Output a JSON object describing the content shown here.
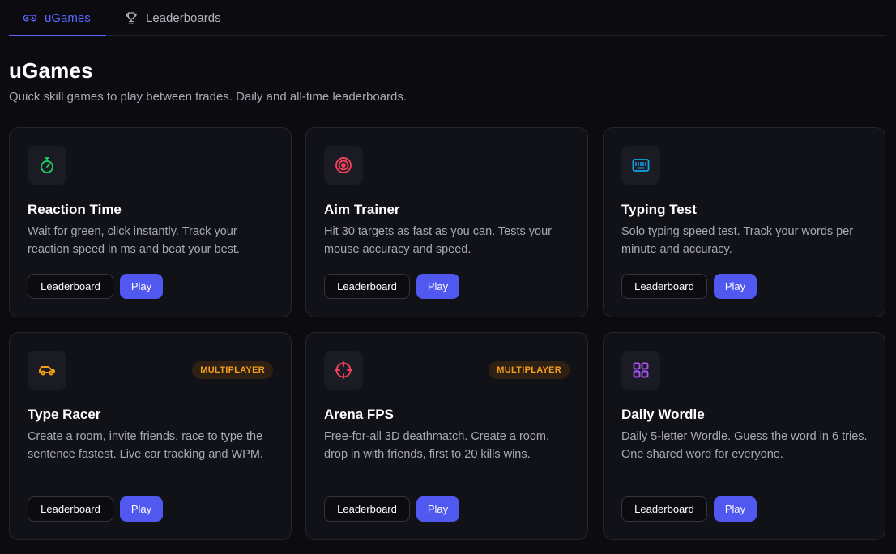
{
  "tabs": [
    {
      "label": "uGames",
      "icon": "gamepad-icon",
      "active": true
    },
    {
      "label": "Leaderboards",
      "icon": "trophy-icon",
      "active": false
    }
  ],
  "header": {
    "title": "uGames",
    "subtitle": "Quick skill games to play between trades. Daily and all-time leaderboards."
  },
  "colors": {
    "accent": "#5b67ff",
    "play_button": "#5058f0",
    "badge_text": "#f59e1b",
    "badge_bg": "#2e2113",
    "background": "#0b0b10",
    "card_bg": "#111118"
  },
  "games": [
    {
      "title": "Reaction Time",
      "description": "Wait for green, click instantly. Track your reaction speed in ms and beat your best.",
      "icon": "stopwatch-icon",
      "icon_color": "#22c55e",
      "badge": "",
      "leaderboard_label": "Leaderboard",
      "play_label": "Play"
    },
    {
      "title": "Aim Trainer",
      "description": "Hit 30 targets as fast as you can. Tests your mouse accuracy and speed.",
      "icon": "target-icon",
      "icon_color": "#f43f5e",
      "badge": "",
      "leaderboard_label": "Leaderboard",
      "play_label": "Play"
    },
    {
      "title": "Typing Test",
      "description": "Solo typing speed test. Track your words per minute and accuracy.",
      "icon": "keyboard-icon",
      "icon_color": "#0ea5e9",
      "badge": "",
      "leaderboard_label": "Leaderboard",
      "play_label": "Play"
    },
    {
      "title": "Type Racer",
      "description": "Create a room, invite friends, race to type the sentence fastest. Live car tracking and WPM.",
      "icon": "car-icon",
      "icon_color": "#f59e0b",
      "badge": "MULTIPLAYER",
      "leaderboard_label": "Leaderboard",
      "play_label": "Play"
    },
    {
      "title": "Arena FPS",
      "description": "Free-for-all 3D deathmatch. Create a room, drop in with friends, first to 20 kills wins.",
      "icon": "crosshair-icon",
      "icon_color": "#f43f5e",
      "badge": "MULTIPLAYER",
      "leaderboard_label": "Leaderboard",
      "play_label": "Play"
    },
    {
      "title": "Daily Wordle",
      "description": "Daily 5-letter Wordle. Guess the word in 6 tries. One shared word for everyone.",
      "icon": "grid-icon",
      "icon_color": "#a855f7",
      "badge": "",
      "leaderboard_label": "Leaderboard",
      "play_label": "Play"
    }
  ]
}
